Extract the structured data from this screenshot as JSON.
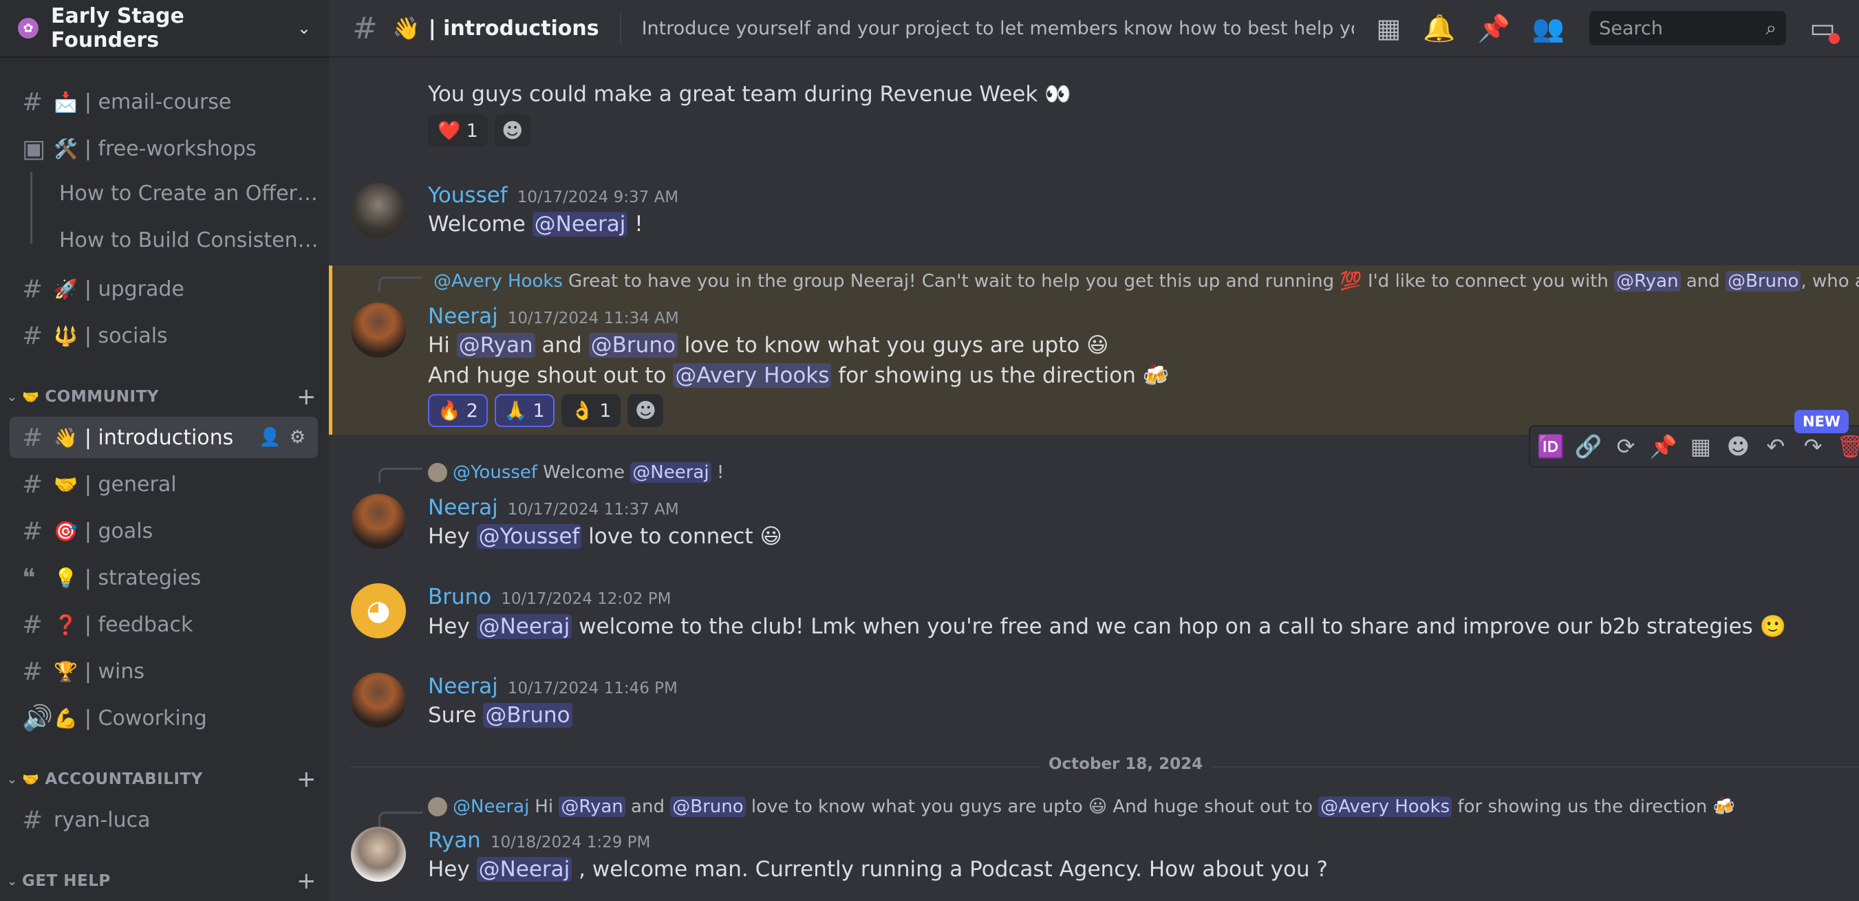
{
  "server": {
    "name": "Early Stage Founders"
  },
  "sidebar": {
    "channels_top": [
      {
        "emoji": "📩",
        "label": "| email-course"
      },
      {
        "emoji": "🛠️",
        "label": "| free-workshops"
      }
    ],
    "threads": [
      "How to Create an Offer ...",
      "How to Build Consistent..."
    ],
    "channels_mid": [
      {
        "emoji": "🚀",
        "label": "| upgrade"
      },
      {
        "emoji": "🔱",
        "label": "| socials"
      }
    ],
    "community": {
      "label": "COMMUNITY",
      "emoji": "🤝",
      "channels": [
        {
          "emoji": "👋",
          "label": "| introductions"
        },
        {
          "emoji": "🤝",
          "label": "| general"
        },
        {
          "emoji": "🎯",
          "label": "| goals"
        },
        {
          "emoji": "💡",
          "label": "| strategies"
        },
        {
          "emoji": "❓",
          "label": "| feedback"
        },
        {
          "emoji": "🏆",
          "label": "| wins"
        },
        {
          "emoji": "💪",
          "label": "| Coworking"
        }
      ]
    },
    "accountability": {
      "label": "ACCOUNTABILITY",
      "emoji": "🤝",
      "channels": [
        {
          "label": "ryan-luca"
        }
      ]
    },
    "get_help": {
      "label": "GET HELP"
    }
  },
  "topbar": {
    "channel_emoji": "👋",
    "channel_name": "| introductions",
    "topic": "Introduce yourself and your project to let members know how to best help you out!",
    "search_placeholder": "Search"
  },
  "messages": {
    "m0": {
      "text": "You guys could make a great team during Revenue Week 👀",
      "reactions": [
        {
          "emoji": "❤️",
          "count": "1"
        }
      ]
    },
    "m1": {
      "author": "Youssef",
      "time": "10/17/2024 9:37 AM",
      "pre": "Welcome ",
      "mention": "@Neeraj",
      "post": " !"
    },
    "m2": {
      "reply_author": "@Avery Hooks",
      "reply_text": "Great to have you in the group Neeraj! Can't wait to help you get this up and running 💯 I'd like to connect you with ",
      "reply_m1": "@Ryan",
      "reply_and": " and ",
      "reply_m2": "@Bruno",
      "reply_tail": ", who are also ...",
      "author": "Neeraj",
      "time": "10/17/2024 11:34 AM",
      "l1_a": "Hi ",
      "l1_m1": "@Ryan",
      "l1_b": " and ",
      "l1_m2": "@Bruno",
      "l1_c": " love to know what you guys are upto 😃",
      "l2_a": "And huge shout out to ",
      "l2_m": "@Avery Hooks",
      "l2_b": " for showing us the direction 🍻",
      "reactions": [
        {
          "emoji": "🔥",
          "count": "2"
        },
        {
          "emoji": "🙏",
          "count": "1"
        },
        {
          "emoji": "👌",
          "count": "1"
        }
      ]
    },
    "m3": {
      "reply_author": "@Youssef",
      "reply_text": "Welcome ",
      "reply_mention": "@Neeraj",
      "reply_tail": " !",
      "author": "Neeraj",
      "time": "10/17/2024 11:37 AM",
      "a": "Hey ",
      "m": "@Youssef",
      "b": " love to connect 😃"
    },
    "m4": {
      "author": "Bruno",
      "time": "10/17/2024 12:02 PM",
      "a": "Hey ",
      "m": "@Neeraj",
      "b": " welcome to the club! Lmk when you're free and we can hop on a call to share and improve our b2b strategies 🙂"
    },
    "m5": {
      "author": "Neeraj",
      "time": "10/17/2024 11:46 PM",
      "a": "Sure ",
      "m": "@Bruno"
    },
    "date_divider": "October 18, 2024",
    "m6": {
      "reply_author": "@Neeraj",
      "reply_a": "Hi ",
      "reply_m1": "@Ryan",
      "reply_b": " and ",
      "reply_m2": "@Bruno",
      "reply_c": " love to know what you guys are upto 😃 And huge shout out to ",
      "reply_m3": "@Avery Hooks",
      "reply_d": " for showing us the direction 🍻",
      "author": "Ryan",
      "time": "10/18/2024 1:29 PM",
      "a": "Hey ",
      "m": "@Neeraj",
      "b": " , welcome man. Currently running a Podcast Agency. How about you ?"
    }
  },
  "hover_toolbar": {
    "new_badge": "NEW"
  },
  "colors": {
    "mention_bg": "#3c4270",
    "highlight_bg": "#433e33",
    "highlight_border": "#f0b232",
    "author": "#5bb3f0"
  }
}
